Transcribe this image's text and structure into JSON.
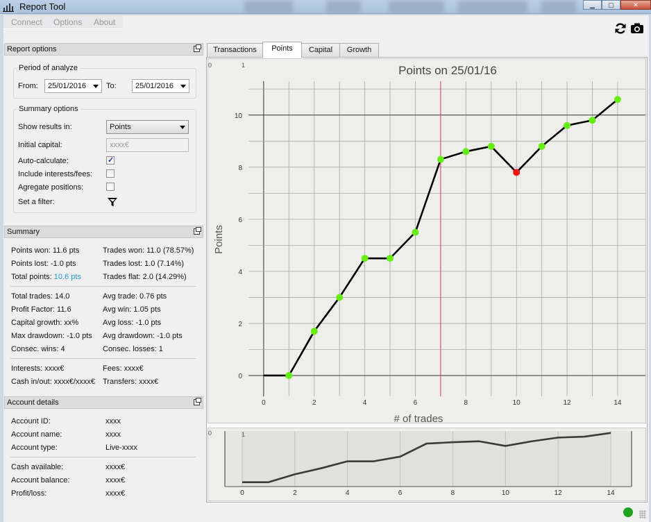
{
  "window": {
    "title": "Report Tool",
    "minimize": "▁",
    "maximize": "▢",
    "close": "✕"
  },
  "menu": {
    "items": [
      "Connect",
      "Options",
      "About"
    ]
  },
  "toolbar": {
    "refresh_icon": "refresh-icon",
    "camera_icon": "camera-icon"
  },
  "report_options": {
    "header": "Report options",
    "period": {
      "title": "Period of analyze",
      "from_label": "From:",
      "from_value": "25/01/2016",
      "to_label": "To:",
      "to_value": "25/01/2016"
    },
    "summary_options": {
      "title": "Summary options",
      "show_results_label": "Show results in:",
      "show_results_value": "Points",
      "initial_capital_label": "Initial capital:",
      "initial_capital_placeholder": "xxxx€",
      "auto_calculate_label": "Auto-calculate:",
      "auto_calculate_checked": true,
      "include_interests_label": "Include interests/fees:",
      "include_interests_checked": false,
      "aggregate_label": "Agregate positions:",
      "aggregate_checked": false,
      "filter_label": "Set a filter:"
    }
  },
  "summary": {
    "header": "Summary",
    "points_won": "Points won: 11.6 pts",
    "points_lost": "Points lost: -1.0 pts",
    "total_points_label": "Total points:",
    "total_points_value": "10.6 pts",
    "trades_won": "Trades won: 11.0 (78.57%)",
    "trades_lost": "Trades lost: 1.0 (7.14%)",
    "trades_flat": "Trades flat: 2.0 (14.29%)",
    "total_trades": "Total trades: 14.0",
    "profit_factor": "Profit Factor: 11.6",
    "capital_growth": "Capital growth: xx%",
    "max_drawdown": "Max drawdown: -1.0 pts",
    "consec_wins": "Consec. wins: 4",
    "avg_trade": "Avg trade: 0.76 pts",
    "avg_win": "Avg win: 1.05 pts",
    "avg_loss": "Avg loss: -1.0 pts",
    "avg_drawdown": "Avg drawdown: -1.0 pts",
    "consec_losses": "Consec. losses: 1",
    "interests": "Interests: xxxx€",
    "fees": "Fees: xxxx€",
    "cash_in_out": "Cash in/out: xxxx€/xxxx€",
    "transfers": "Transfers: xxxx€"
  },
  "account": {
    "header": "Account details",
    "rows": [
      {
        "label": "Account ID:",
        "value": "xxxx"
      },
      {
        "label": "Account name:",
        "value": "xxxx"
      },
      {
        "label": "Account type:",
        "value": "Live-xxxx"
      },
      {
        "label": "Cash available:",
        "value": "xxxx€"
      },
      {
        "label": "Account balance:",
        "value": "xxxx€"
      },
      {
        "label": "Profit/loss:",
        "value": "xxxx€"
      }
    ]
  },
  "tabs": [
    "Transactions",
    "Points",
    "Capital",
    "Growth"
  ],
  "active_tab": "Points",
  "colors": {
    "point_green": "#66ee11",
    "point_red": "#ff1111",
    "line": "#000000",
    "vline": "#d04050",
    "overview_line": "#3a3a3a",
    "status": "#1fa31f",
    "link_blue": "#1a9ad8"
  },
  "chart_data": [
    {
      "type": "line",
      "title": "Points on 25/01/16",
      "xlabel": "# of trades",
      "ylabel": "Points",
      "x": [
        0,
        1,
        2,
        3,
        4,
        5,
        6,
        7,
        8,
        9,
        10,
        11,
        12,
        13,
        14
      ],
      "y": [
        0,
        0,
        1.7,
        3.0,
        4.5,
        4.5,
        5.5,
        8.3,
        8.6,
        8.8,
        7.8,
        8.8,
        9.6,
        9.8,
        10.6
      ],
      "loss_points": [
        10
      ],
      "marker_free_points": [
        0
      ],
      "xlim": [
        -0.6,
        15.1
      ],
      "ylim": [
        -0.8,
        11.3
      ],
      "xticks": [
        0,
        2,
        4,
        6,
        8,
        10,
        12,
        14
      ],
      "yticks": [
        0,
        2,
        4,
        6,
        8,
        10
      ],
      "vertical_marker_x": 7,
      "grid": true,
      "corner_labels": [
        "0",
        "1"
      ]
    },
    {
      "type": "line",
      "title": "",
      "x": [
        0,
        1,
        2,
        3,
        4,
        5,
        6,
        7,
        8,
        9,
        10,
        11,
        12,
        13,
        14
      ],
      "y": [
        0,
        0,
        1.7,
        3.0,
        4.5,
        4.5,
        5.5,
        8.3,
        8.6,
        8.8,
        7.8,
        8.8,
        9.6,
        9.8,
        10.6
      ],
      "xlim": [
        -0.6,
        15.1
      ],
      "xticks": [
        0,
        2,
        4,
        6,
        8,
        10,
        12,
        14
      ],
      "grid": true,
      "corner_labels": [
        "0",
        "1"
      ]
    }
  ]
}
